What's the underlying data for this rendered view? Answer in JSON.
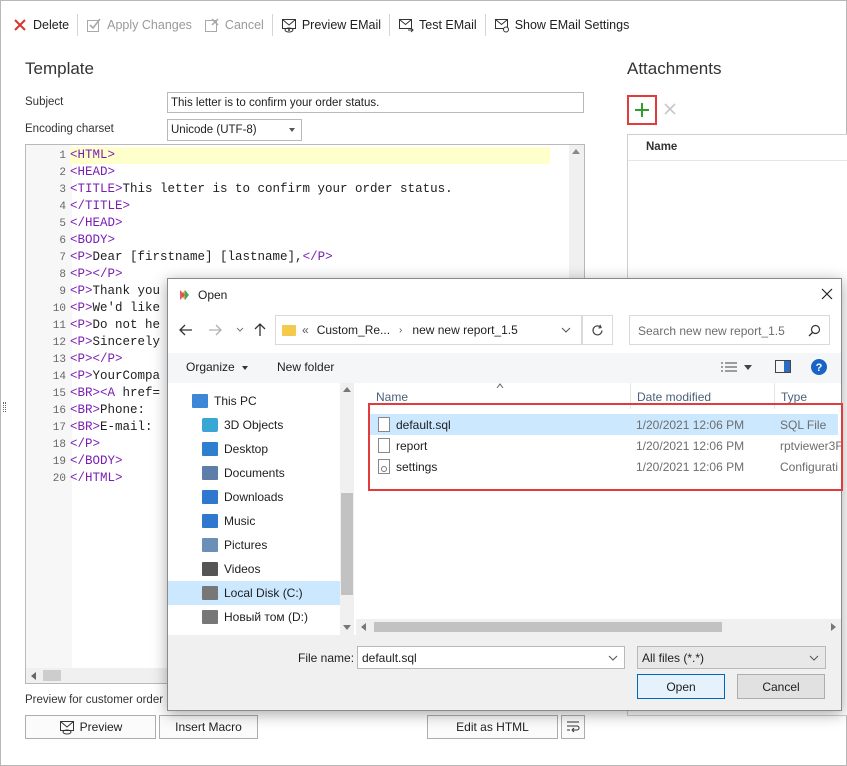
{
  "toolbar": {
    "items": [
      {
        "label": "Delete",
        "icon": "close-icon",
        "enabled": true
      },
      {
        "label": "Apply Changes",
        "icon": "check-icon",
        "enabled": false
      },
      {
        "label": "Cancel",
        "icon": "cancel-icon",
        "enabled": false
      },
      {
        "label": "Preview EMail",
        "icon": "envelope-preview-icon",
        "enabled": true
      },
      {
        "label": "Test EMail",
        "icon": "envelope-send-icon",
        "enabled": true
      },
      {
        "label": "Show EMail Settings",
        "icon": "envelope-settings-icon",
        "enabled": true
      }
    ]
  },
  "template": {
    "title": "Template",
    "subject_label": "Subject",
    "subject_value": "This letter is to confirm your order status.",
    "charset_label": "Encoding charset",
    "charset_value": "Unicode (UTF-8)",
    "code_lines": [
      {
        "n": "1",
        "parts": [
          [
            "t",
            "<HTML>"
          ]
        ]
      },
      {
        "n": "2",
        "parts": [
          [
            "t",
            "<HEAD>"
          ]
        ]
      },
      {
        "n": "3",
        "parts": [
          [
            "t",
            "<TITLE>"
          ],
          [
            "x",
            "This letter is to confirm your order status."
          ]
        ]
      },
      {
        "n": "4",
        "parts": [
          [
            "t",
            "</TITLE>"
          ]
        ]
      },
      {
        "n": "5",
        "parts": [
          [
            "t",
            "</HEAD>"
          ]
        ]
      },
      {
        "n": "6",
        "parts": [
          [
            "t",
            "<BODY>"
          ]
        ]
      },
      {
        "n": "7",
        "parts": [
          [
            "t",
            "<P>"
          ],
          [
            "x",
            "Dear [firstname] [lastname],"
          ],
          [
            "t",
            "</P>"
          ]
        ]
      },
      {
        "n": "8",
        "parts": [
          [
            "t",
            "<P>"
          ],
          [
            "t",
            "</P>"
          ]
        ]
      },
      {
        "n": "9",
        "parts": [
          [
            "t",
            "<P>"
          ],
          [
            "x",
            "Thank you"
          ]
        ]
      },
      {
        "n": "10",
        "parts": [
          [
            "t",
            "<P>"
          ],
          [
            "x",
            "We'd like"
          ]
        ]
      },
      {
        "n": "11",
        "parts": [
          [
            "t",
            "<P>"
          ],
          [
            "x",
            "Do not he"
          ]
        ]
      },
      {
        "n": "12",
        "parts": [
          [
            "t",
            "<P>"
          ],
          [
            "x",
            "Sincerely"
          ]
        ]
      },
      {
        "n": "13",
        "parts": [
          [
            "t",
            "<P>"
          ],
          [
            "t",
            "</P>"
          ]
        ]
      },
      {
        "n": "14",
        "parts": [
          [
            "t",
            "<P>"
          ],
          [
            "x",
            "YourCompa"
          ]
        ]
      },
      {
        "n": "15",
        "parts": [
          [
            "t",
            "<BR>"
          ],
          [
            "t",
            "<A "
          ],
          [
            "x",
            "href="
          ]
        ]
      },
      {
        "n": "16",
        "parts": [
          [
            "t",
            "<BR>"
          ],
          [
            "x",
            "Phone: "
          ]
        ]
      },
      {
        "n": "17",
        "parts": [
          [
            "t",
            "<BR>"
          ],
          [
            "x",
            "E-mail: "
          ]
        ]
      },
      {
        "n": "18",
        "parts": [
          [
            "t",
            "</P>"
          ]
        ]
      },
      {
        "n": "19",
        "parts": [
          [
            "t",
            "</BODY>"
          ]
        ]
      },
      {
        "n": "20",
        "parts": [
          [
            "t",
            "</HTML>"
          ]
        ]
      }
    ],
    "preview_for_label": "Preview for customer order",
    "preview_button": "Preview",
    "insert_macro_button": "Insert Macro",
    "edit_as_html_button": "Edit as HTML"
  },
  "attachments": {
    "title": "Attachments",
    "column_name": "Name"
  },
  "dialog": {
    "title": "Open",
    "path": {
      "overflow": "«",
      "segment1": "Custom_Re...",
      "segment2": "new new report_1.5"
    },
    "search_placeholder": "Search new new report_1.5",
    "organize_label": "Organize",
    "new_folder_label": "New folder",
    "nav_items": [
      {
        "label": "This PC",
        "icon": "computer-icon"
      },
      {
        "label": "3D Objects",
        "icon": "cube-icon"
      },
      {
        "label": "Desktop",
        "icon": "desktop-icon"
      },
      {
        "label": "Documents",
        "icon": "document-icon"
      },
      {
        "label": "Downloads",
        "icon": "download-icon"
      },
      {
        "label": "Music",
        "icon": "music-icon"
      },
      {
        "label": "Pictures",
        "icon": "pictures-icon"
      },
      {
        "label": "Videos",
        "icon": "video-icon"
      },
      {
        "label": "Local Disk (C:)",
        "icon": "drive-icon"
      },
      {
        "label": "Новый том (D:)",
        "icon": "drive-icon"
      }
    ],
    "columns": {
      "name": "Name",
      "date": "Date modified",
      "type": "Type"
    },
    "files": [
      {
        "name": "default.sql",
        "date": "1/20/2021 12:06 PM",
        "type": "SQL File",
        "selected": true
      },
      {
        "name": "report",
        "date": "1/20/2021 12:06 PM",
        "type": "rptviewer3F",
        "selected": false
      },
      {
        "name": "settings",
        "date": "1/20/2021 12:06 PM",
        "type": "Configurati",
        "selected": false
      }
    ],
    "filename_label": "File name:",
    "filename_value": "default.sql",
    "filter_value": "All files (*.*)",
    "open_button": "Open",
    "cancel_button": "Cancel"
  },
  "colors": {
    "accent": "#0067c0",
    "highlight_red": "#e23b3b",
    "selection": "#cce8ff",
    "tag_purple": "#7a1fb4",
    "line_highlight": "#ffffcc"
  }
}
